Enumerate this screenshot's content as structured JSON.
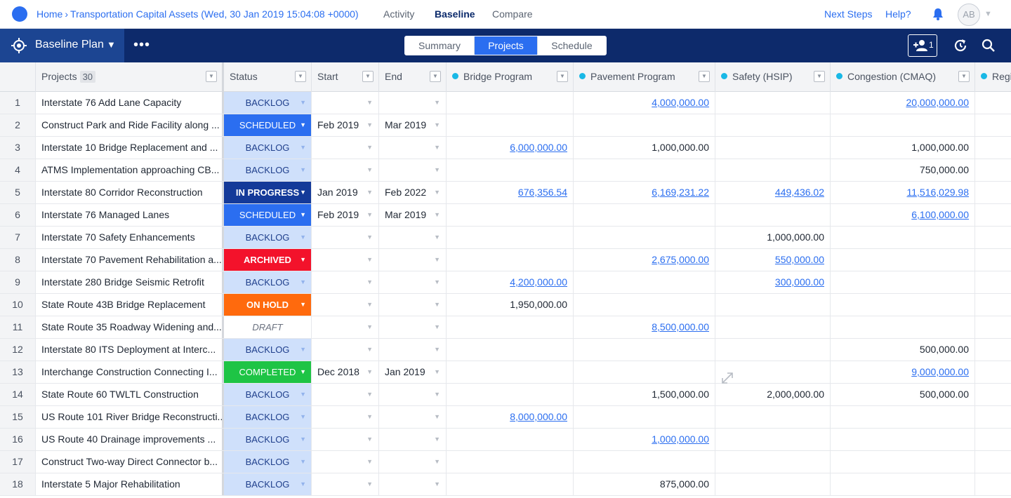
{
  "topnav": {
    "breadcrumb_home": "Home",
    "breadcrumb_sep": "›",
    "breadcrumb_current": "Transportation Capital Assets (Wed, 30 Jan 2019 15:04:08 +0000)",
    "tabs": [
      {
        "label": "Activity",
        "active": false
      },
      {
        "label": "Baseline",
        "active": true
      },
      {
        "label": "Compare",
        "active": false
      }
    ],
    "next_steps": "Next Steps",
    "help": "Help?",
    "avatar_initials": "AB",
    "icons": {
      "bell": "bell-icon",
      "chevron": "chevron-down-icon"
    }
  },
  "toolbar": {
    "plan_label": "Baseline Plan",
    "more": "•••",
    "views": [
      {
        "label": "Summary",
        "active": false
      },
      {
        "label": "Projects",
        "active": true
      },
      {
        "label": "Schedule",
        "active": false
      }
    ],
    "add_user_badge": "1",
    "icons": {
      "target": "target-icon",
      "add_user": "add-user-icon",
      "refresh": "refresh-icon",
      "search": "search-icon"
    }
  },
  "colors": {
    "accent": "#2b6ef0",
    "toolbar_bg": "#0d2a6b",
    "plan_btn_bg": "#1c4592",
    "program_dot": "#18b8e6"
  },
  "grid": {
    "headers": {
      "projects": "Projects",
      "projects_count": "30",
      "status": "Status",
      "start": "Start",
      "end": "End",
      "bridge": "Bridge Program",
      "pavement": "Pavement Program",
      "safety": "Safety (HSIP)",
      "congestion": "Congestion (CMAQ)",
      "regional": "Regi"
    },
    "rows": [
      {
        "num": "1",
        "project": "Interstate 76 Add Lane Capacity",
        "status": "BACKLOG",
        "start": "",
        "end": "",
        "bridge": "",
        "bridge_link": false,
        "pavement": "4,000,000.00",
        "pavement_link": true,
        "safety": "",
        "safety_link": false,
        "congestion": "20,000,000.00",
        "congestion_link": true
      },
      {
        "num": "2",
        "project": "Construct Park and Ride Facility along ...",
        "status": "SCHEDULED",
        "start": "Feb 2019",
        "end": "Mar 2019",
        "bridge": "",
        "bridge_link": false,
        "pavement": "",
        "pavement_link": false,
        "safety": "",
        "safety_link": false,
        "congestion": "",
        "congestion_link": false
      },
      {
        "num": "3",
        "project": "Interstate 10 Bridge Replacement and ...",
        "status": "BACKLOG",
        "start": "",
        "end": "",
        "bridge": "6,000,000.00",
        "bridge_link": true,
        "pavement": "1,000,000.00",
        "pavement_link": false,
        "safety": "",
        "safety_link": false,
        "congestion": "1,000,000.00",
        "congestion_link": false
      },
      {
        "num": "4",
        "project": "ATMS Implementation approaching CB...",
        "status": "BACKLOG",
        "start": "",
        "end": "",
        "bridge": "",
        "bridge_link": false,
        "pavement": "",
        "pavement_link": false,
        "safety": "",
        "safety_link": false,
        "congestion": "750,000.00",
        "congestion_link": false
      },
      {
        "num": "5",
        "project": "Interstate 80 Corridor Reconstruction",
        "status": "IN PROGRESS",
        "start": "Jan 2019",
        "end": "Feb 2022",
        "bridge": "676,356.54",
        "bridge_link": true,
        "pavement": "6,169,231.22",
        "pavement_link": true,
        "safety": "449,436.02",
        "safety_link": true,
        "congestion": "11,516,029.98",
        "congestion_link": true
      },
      {
        "num": "6",
        "project": "Interstate 76 Managed Lanes",
        "status": "SCHEDULED",
        "start": "Feb 2019",
        "end": "Mar 2019",
        "bridge": "",
        "bridge_link": false,
        "pavement": "",
        "pavement_link": false,
        "safety": "",
        "safety_link": false,
        "congestion": "6,100,000.00",
        "congestion_link": true
      },
      {
        "num": "7",
        "project": "Interstate 70 Safety Enhancements",
        "status": "BACKLOG",
        "start": "",
        "end": "",
        "bridge": "",
        "bridge_link": false,
        "pavement": "",
        "pavement_link": false,
        "safety": "1,000,000.00",
        "safety_link": false,
        "congestion": "",
        "congestion_link": false
      },
      {
        "num": "8",
        "project": "Interstate 70 Pavement Rehabilitation a...",
        "status": "ARCHIVED",
        "start": "",
        "end": "",
        "bridge": "",
        "bridge_link": false,
        "pavement": "2,675,000.00",
        "pavement_link": true,
        "safety": "550,000.00",
        "safety_link": true,
        "congestion": "",
        "congestion_link": false
      },
      {
        "num": "9",
        "project": "Interstate 280 Bridge Seismic Retrofit",
        "status": "BACKLOG",
        "start": "",
        "end": "",
        "bridge": "4,200,000.00",
        "bridge_link": true,
        "pavement": "",
        "pavement_link": false,
        "safety": "300,000.00",
        "safety_link": true,
        "congestion": "",
        "congestion_link": false
      },
      {
        "num": "10",
        "project": "State Route 43B Bridge Replacement",
        "status": "ON HOLD",
        "start": "",
        "end": "",
        "bridge": "1,950,000.00",
        "bridge_link": false,
        "pavement": "",
        "pavement_link": false,
        "safety": "",
        "safety_link": false,
        "congestion": "",
        "congestion_link": false
      },
      {
        "num": "11",
        "project": "State Route 35 Roadway Widening and...",
        "status": "DRAFT",
        "start": "",
        "end": "",
        "bridge": "",
        "bridge_link": false,
        "pavement": "8,500,000.00",
        "pavement_link": true,
        "safety": "",
        "safety_link": false,
        "congestion": "",
        "congestion_link": false
      },
      {
        "num": "12",
        "project": "Interstate 80 ITS Deployment at Interc...",
        "status": "BACKLOG",
        "start": "",
        "end": "",
        "bridge": "",
        "bridge_link": false,
        "pavement": "",
        "pavement_link": false,
        "safety": "",
        "safety_link": false,
        "congestion": "500,000.00",
        "congestion_link": false
      },
      {
        "num": "13",
        "project": "Interchange Construction Connecting I...",
        "status": "COMPLETED",
        "start": "Dec 2018",
        "end": "Jan 2019",
        "bridge": "",
        "bridge_link": false,
        "pavement": "",
        "pavement_link": false,
        "safety": "",
        "safety_link": false,
        "congestion": "9,000,000.00",
        "congestion_link": true
      },
      {
        "num": "14",
        "project": "State Route 60 TWLTL Construction",
        "status": "BACKLOG",
        "start": "",
        "end": "",
        "bridge": "",
        "bridge_link": false,
        "pavement": "1,500,000.00",
        "pavement_link": false,
        "safety": "2,000,000.00",
        "safety_link": false,
        "congestion": "500,000.00",
        "congestion_link": false
      },
      {
        "num": "15",
        "project": "US Route 101 River Bridge Reconstructi...",
        "status": "BACKLOG",
        "start": "",
        "end": "",
        "bridge": "8,000,000.00",
        "bridge_link": true,
        "pavement": "",
        "pavement_link": false,
        "safety": "",
        "safety_link": false,
        "congestion": "",
        "congestion_link": false
      },
      {
        "num": "16",
        "project": "US Route 40 Drainage improvements ...",
        "status": "BACKLOG",
        "start": "",
        "end": "",
        "bridge": "",
        "bridge_link": false,
        "pavement": "1,000,000.00",
        "pavement_link": true,
        "safety": "",
        "safety_link": false,
        "congestion": "",
        "congestion_link": false
      },
      {
        "num": "17",
        "project": "Construct Two-way Direct Connector b...",
        "status": "BACKLOG",
        "start": "",
        "end": "",
        "bridge": "",
        "bridge_link": false,
        "pavement": "",
        "pavement_link": false,
        "safety": "",
        "safety_link": false,
        "congestion": "",
        "congestion_link": false
      },
      {
        "num": "18",
        "project": "Interstate 5 Major Rehabilitation",
        "status": "BACKLOG",
        "start": "",
        "end": "",
        "bridge": "",
        "bridge_link": false,
        "pavement": "875,000.00",
        "pavement_link": false,
        "safety": "",
        "safety_link": false,
        "congestion": "",
        "congestion_link": false
      }
    ]
  }
}
